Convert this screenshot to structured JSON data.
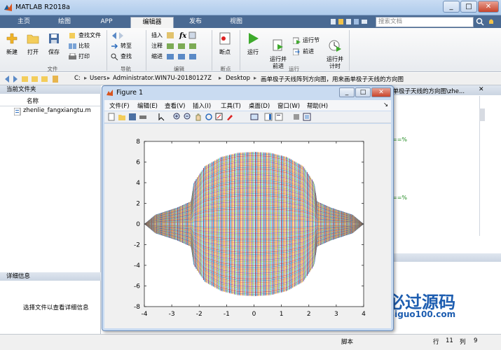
{
  "window": {
    "title": "MATLAB R2018a",
    "controls": [
      "_",
      "□",
      "✕"
    ]
  },
  "tabs": [
    {
      "label": "主页"
    },
    {
      "label": "绘图"
    },
    {
      "label": "APP"
    },
    {
      "label": "编辑器"
    },
    {
      "label": "发布"
    },
    {
      "label": "视图"
    }
  ],
  "search_placeholder": "搜索文档",
  "ribbon": {
    "file": {
      "new": "新建",
      "open": "打开",
      "save": "保存",
      "find_files": "查找文件",
      "compare": "比较",
      "print": "打印",
      "section": "文件"
    },
    "nav": {
      "goto": "转至",
      "find": "查找",
      "section": "导航"
    },
    "edit": {
      "insert": "插入",
      "comment": "注释",
      "indent": "缩进",
      "fx": "fx",
      "section": "编辑"
    },
    "breakpoints": {
      "label": "断点",
      "section": "断点"
    },
    "run": {
      "run": "运行",
      "run_advance": "运行并\n前进",
      "run_section": "运行节",
      "advance": "前进",
      "run_time": "运行并\n计时",
      "section": "运行"
    }
  },
  "address": [
    "C:",
    "Users",
    "Administrator.WIN7U-20180127Z",
    "Desktop",
    "画单极子天线阵列方向图，用来画单极子天线的方向图"
  ],
  "current_folder": {
    "title": "当前文件夹",
    "name_col": "名称",
    "files": [
      "zhenlie_fangxiangtu.m"
    ]
  },
  "details": {
    "title": "详细信息",
    "hint": "选择文件以查看详细信息"
  },
  "editor_tab": "画单极子天线的方向图\\zhe...",
  "statusbar": {
    "script": "脚本",
    "row_label": "行",
    "row": "11",
    "col_label": "列",
    "col": "9"
  },
  "watermark": {
    "name": "必过源码",
    "url": "Biguo100.com"
  },
  "figure": {
    "title": "Figure 1",
    "menu": [
      "文件(F)",
      "编辑(E)",
      "查看(V)",
      "插入(I)",
      "工具(T)",
      "桌面(D)",
      "窗口(W)",
      "帮助(H)"
    ],
    "chart_data": {
      "type": "line",
      "title": "",
      "xlabel": "",
      "ylabel": "",
      "xlim": [
        -4,
        4
      ],
      "ylim": [
        -8,
        8
      ],
      "xticks": [
        -4,
        -3,
        -2,
        -1,
        0,
        1,
        2,
        3,
        4
      ],
      "yticks": [
        -8,
        -6,
        -4,
        -2,
        0,
        2,
        4,
        6,
        8
      ],
      "series_description": "dense family of closed colored curves",
      "outline": {
        "x": [
          -4.0,
          -3.6,
          -2.8,
          -2.3,
          -2.2,
          -1.8,
          -1.2,
          -0.6,
          0,
          0.6,
          1.2,
          1.8,
          2.2,
          2.3,
          2.8,
          3.6,
          4.0
        ],
        "y": [
          0.0,
          0.9,
          1.6,
          2.2,
          4.0,
          5.6,
          6.5,
          6.9,
          7.0,
          6.9,
          6.5,
          5.6,
          4.0,
          2.2,
          1.6,
          0.9,
          0.0
        ]
      },
      "colors": [
        "#0072bd",
        "#d95319",
        "#edb120",
        "#7e2f8e",
        "#77ac30",
        "#4dbeee",
        "#a2142f"
      ]
    }
  }
}
